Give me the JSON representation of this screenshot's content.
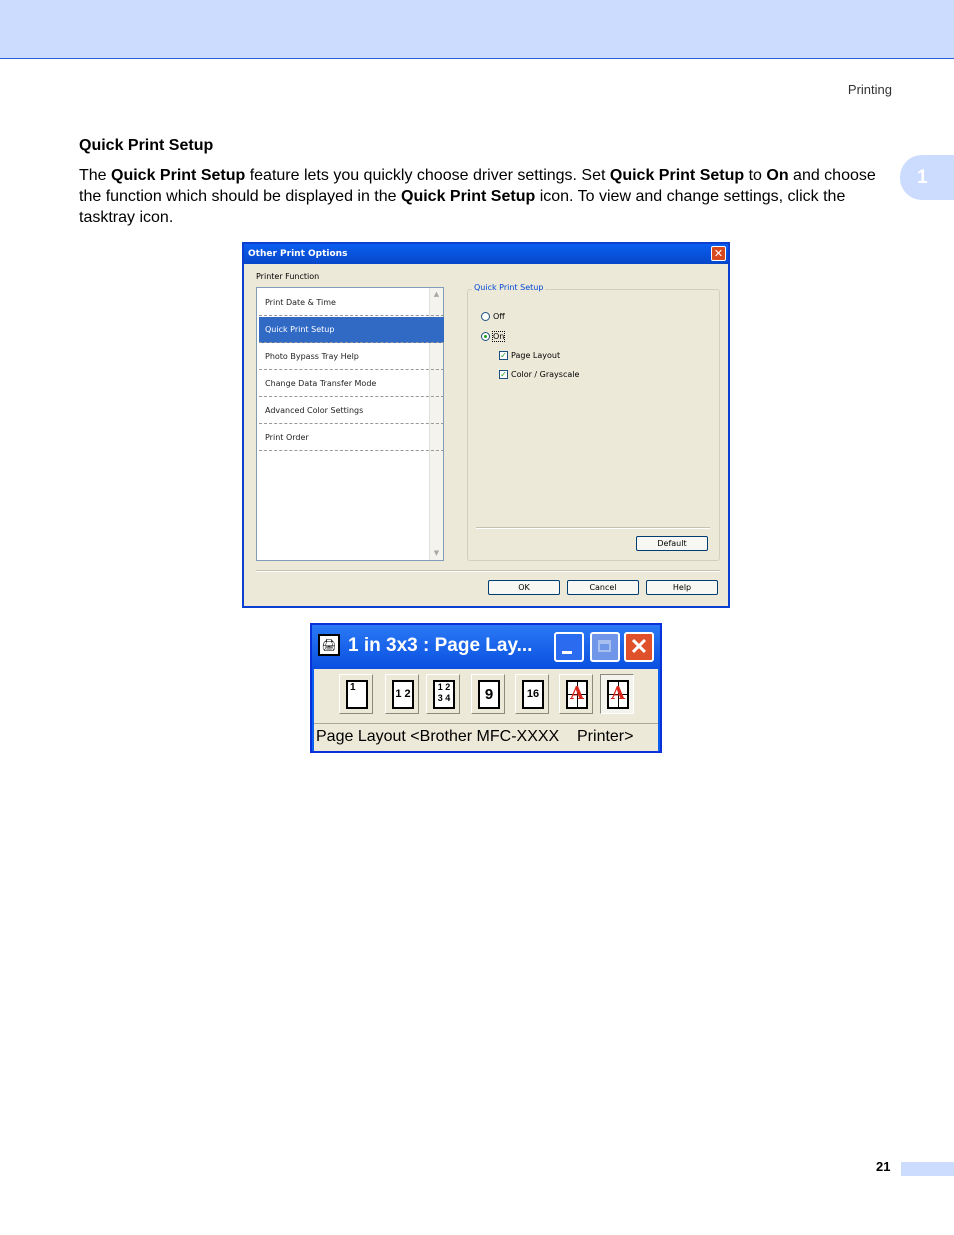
{
  "header": {
    "running_title": "Printing",
    "chapter_tab": "1"
  },
  "section": {
    "heading": "Quick Print Setup",
    "paragraph": [
      {
        "t": "The ",
        "b": false
      },
      {
        "t": "Quick Print Setup",
        "b": true
      },
      {
        "t": " feature lets you quickly choose driver settings. Set ",
        "b": false
      },
      {
        "t": "Quick Print Setup",
        "b": true
      },
      {
        "t": " to ",
        "b": false
      },
      {
        "t": "On",
        "b": true
      },
      {
        "t": " and choose the function which should be displayed in the ",
        "b": false
      },
      {
        "t": "Quick Print Setup",
        "b": true
      },
      {
        "t": " icon. To view and change settings, click the tasktray icon.",
        "b": false
      }
    ]
  },
  "dialog": {
    "title": "Other Print Options",
    "close_glyph": "✕",
    "list_label": "Printer Function",
    "list_items": [
      "Print Date & Time",
      "Quick Print Setup",
      "Photo Bypass Tray Help",
      "Change Data Transfer Mode",
      "Advanced Color Settings",
      "Print Order"
    ],
    "selected_item": "Quick Print Setup",
    "group_title": "Quick Print Setup",
    "radio_off": "Off",
    "radio_on": "On",
    "radio_selected": "On",
    "check_page_layout": "Page Layout",
    "check_color": "Color / Grayscale",
    "checks_checked": [
      true,
      true
    ],
    "default_button": "Default",
    "ok_button": "OK",
    "cancel_button": "Cancel",
    "help_button": "Help"
  },
  "toolbar_window": {
    "title": "1 in 3x3 : Page Lay...",
    "icons": [
      "page-1-up-icon",
      "page-2-up-icon",
      "page-4-up-icon",
      "page-9-up-icon",
      "page-16-up-icon",
      "poster-2x2-icon",
      "poster-3x3-icon"
    ],
    "tool_labels": [
      "1",
      "1 2",
      "1 2\n3 4",
      "9",
      "16",
      "A",
      "A"
    ],
    "active_tool": "poster-3x3-icon",
    "status_text": "Page Layout <Brother MFC-XXXX    Printer>",
    "accent_red": "#d9271e"
  },
  "footer": {
    "page_number": "21"
  }
}
